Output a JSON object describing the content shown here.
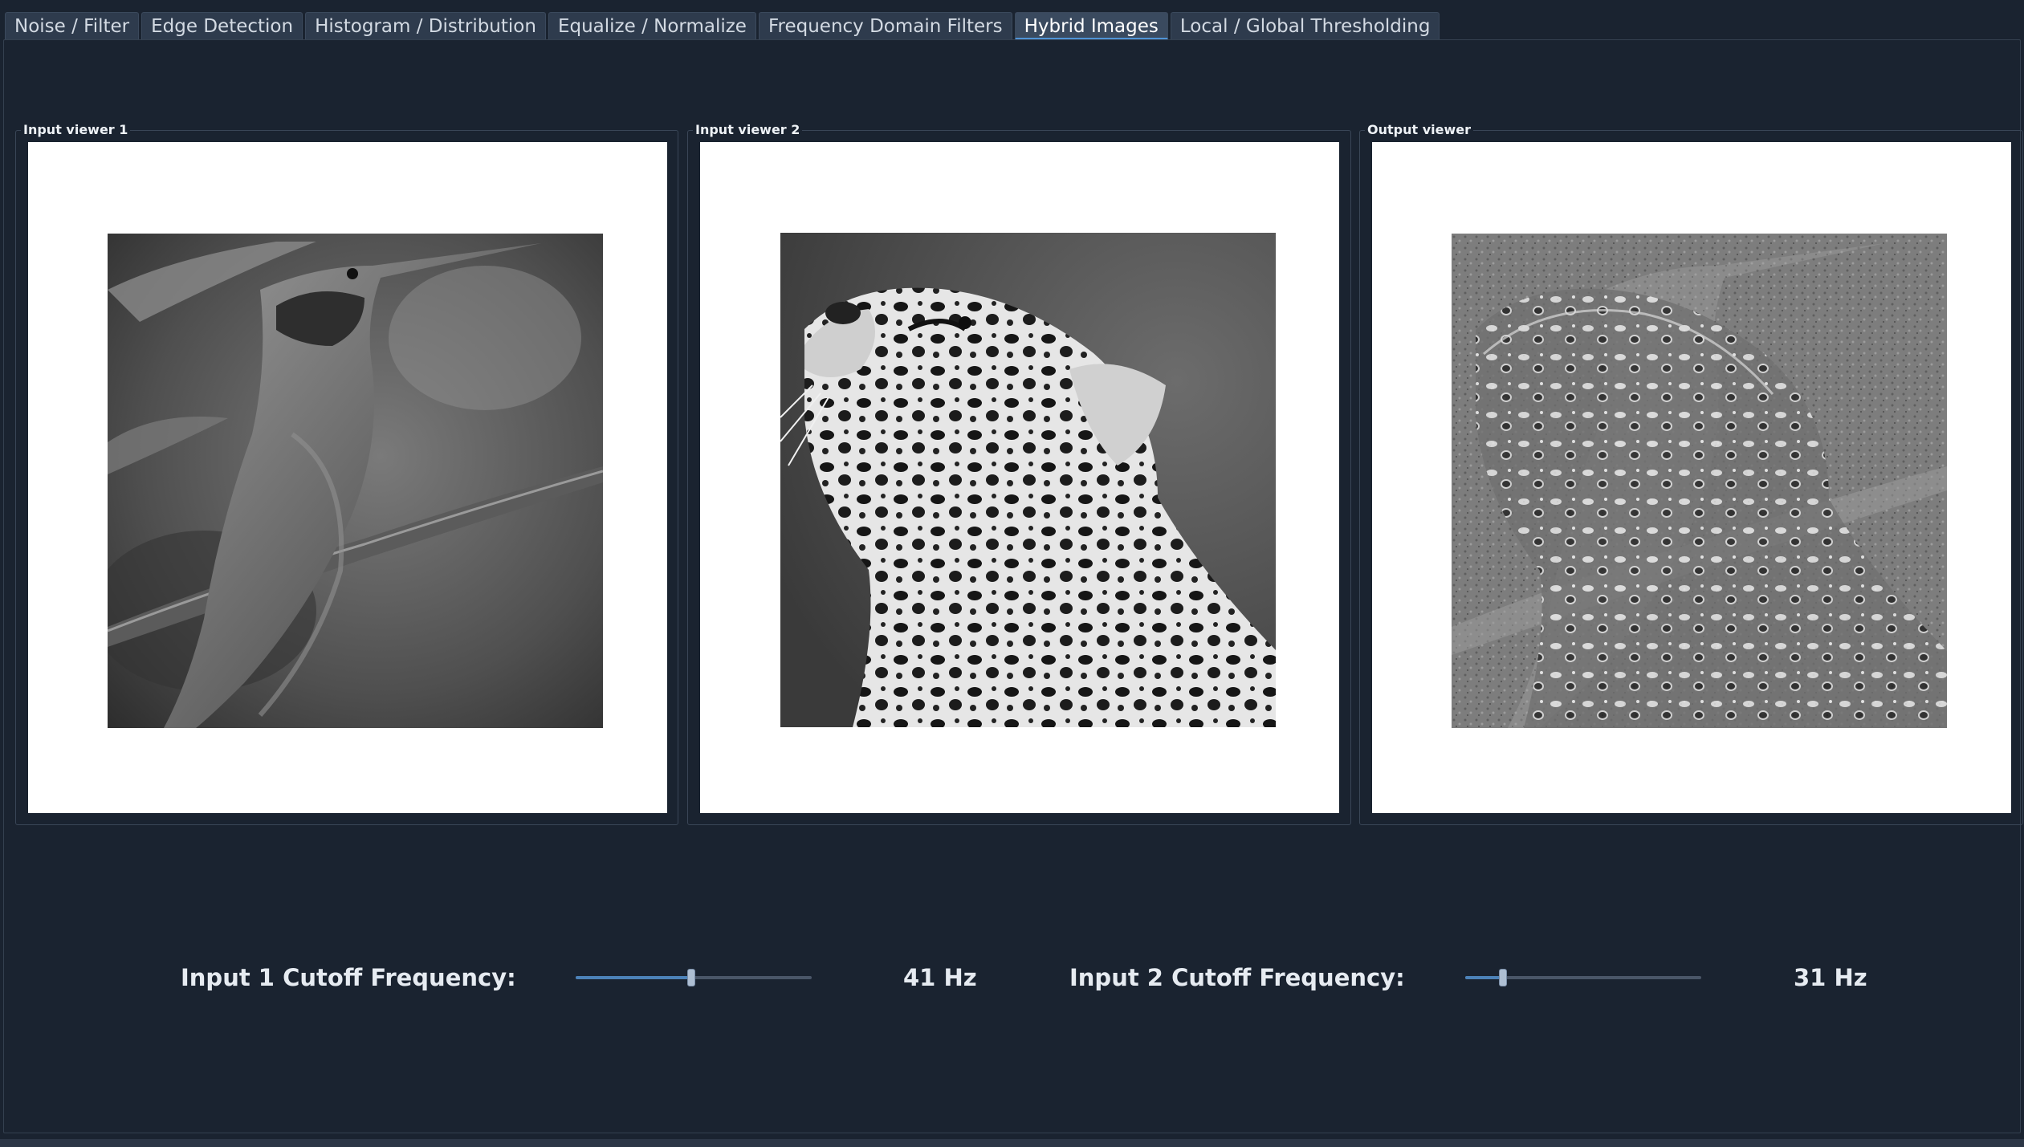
{
  "tabs": [
    {
      "label": "Noise / Filter",
      "active": false
    },
    {
      "label": "Edge Detection",
      "active": false
    },
    {
      "label": "Histogram / Distribution",
      "active": false
    },
    {
      "label": "Equalize / Normalize",
      "active": false
    },
    {
      "label": "Frequency Domain Filters",
      "active": false
    },
    {
      "label": "Hybrid Images",
      "active": true
    },
    {
      "label": "Local / Global Thresholding",
      "active": false
    }
  ],
  "viewers": {
    "input1": {
      "title": "Input viewer 1",
      "image": "grayscale hummingbird photo"
    },
    "input2": {
      "title": "Input viewer 2",
      "image": "grayscale jaguar photo"
    },
    "output": {
      "title": "Output viewer",
      "image": "hybrid image result"
    }
  },
  "controls": {
    "input1": {
      "label": "Input 1 Cutoff Frequency:",
      "value_text": "41 Hz",
      "slider_fraction": 0.49
    },
    "input2": {
      "label": "Input 2 Cutoff Frequency:",
      "value_text": "31 Hz",
      "slider_fraction": 0.16
    }
  },
  "colors": {
    "background": "#1a2330",
    "tab": "#2e3b4d",
    "tab_active_underline": "#4f93d6",
    "slider_fill": "#4c82b8"
  }
}
